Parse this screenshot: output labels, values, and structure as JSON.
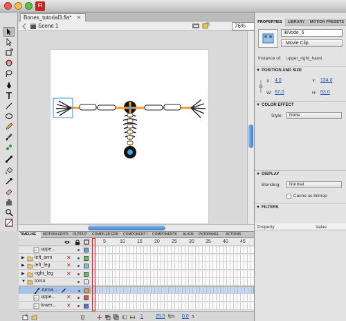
{
  "window": {
    "app_badge": "Fl",
    "traffic_lights": {
      "close": "#ee5b52",
      "minimize": "#f4be3e",
      "zoom": "#58c644"
    },
    "app_badge_color": "#c8251e"
  },
  "document": {
    "tab_title": "Bones_tutorial3.fla*",
    "close_glyph": "✕",
    "scene_label": "Scene 1",
    "zoom_value": "76%"
  },
  "colors": {
    "bone_orange": "#f39a2b",
    "selection_blue": "#2a8fd8",
    "accent_blue": "#1d57b5"
  },
  "properties": {
    "tabs": [
      "PROPERTIES",
      "LIBRARY",
      "MOTION PRESETS"
    ],
    "instance_name": "ikNode_6",
    "symbol_type": "Movie Clip",
    "instance_of_label": "Instance of:",
    "instance_of_value": "upper_right_hand",
    "position_size": {
      "header": "POSITION AND SIZE",
      "x_label": "X:",
      "x_value": "4.0",
      "y_label": "Y:",
      "y_value": "134.0",
      "w_label": "W:",
      "w_value": "67.0",
      "h_label": "H:",
      "h_value": "63.0"
    },
    "color_effect": {
      "header": "COLOR EFFECT",
      "style_label": "Style:",
      "style_value": "None"
    },
    "display": {
      "header": "DISPLAY",
      "blending_label": "Blending:",
      "blending_value": "Normal",
      "cache_label": "Cache as bitmap"
    },
    "filters": {
      "header": "FILTERS",
      "col_property": "Property",
      "col_value": "Value"
    }
  },
  "timeline": {
    "tabs": [
      "TIMELINE",
      "MOTION EDITO",
      "OUTPUT",
      "COMPILER ERR",
      "COMPONENT I",
      "COMPONENTS",
      "ALIGN",
      "PV3DPANEL",
      "ACTIONS"
    ],
    "frame_numbers": [
      "5",
      "10",
      "15",
      "20",
      "25",
      "30",
      "35",
      "40",
      "45"
    ],
    "layers": [
      {
        "name": "uppe...",
        "indent": 2,
        "folder": false,
        "hidden": false,
        "color": "#5aa0e6",
        "selected": false,
        "expanded": false
      },
      {
        "name": "left_arm",
        "indent": 1,
        "folder": true,
        "hidden": true,
        "color": "#63c24d",
        "selected": false,
        "expanded": false
      },
      {
        "name": "left_leg",
        "indent": 1,
        "folder": true,
        "hidden": true,
        "color": "#5fd0d4",
        "selected": false,
        "expanded": false
      },
      {
        "name": "right_leg",
        "indent": 1,
        "folder": true,
        "hidden": true,
        "color": "#63c24d",
        "selected": false,
        "expanded": false
      },
      {
        "name": "torso",
        "indent": 1,
        "folder": true,
        "hidden": false,
        "color": "#e9e9e9",
        "selected": false,
        "expanded": true
      },
      {
        "name": "Arma...",
        "indent": 2,
        "folder": false,
        "hidden": false,
        "color": "#f39a2b",
        "selected": true,
        "expanded": false
      },
      {
        "name": "uppe...",
        "indent": 2,
        "folder": false,
        "hidden": true,
        "color": "#e35050",
        "selected": false,
        "expanded": false
      },
      {
        "name": "lower...",
        "indent": 2,
        "folder": false,
        "hidden": true,
        "color": "#4f6fe3",
        "selected": false,
        "expanded": false
      }
    ],
    "hidden_glyph": "✕",
    "footer": {
      "frame": "1",
      "fps": "25.0",
      "fps_unit": "fps",
      "time": "0.0",
      "time_unit": "s"
    }
  }
}
